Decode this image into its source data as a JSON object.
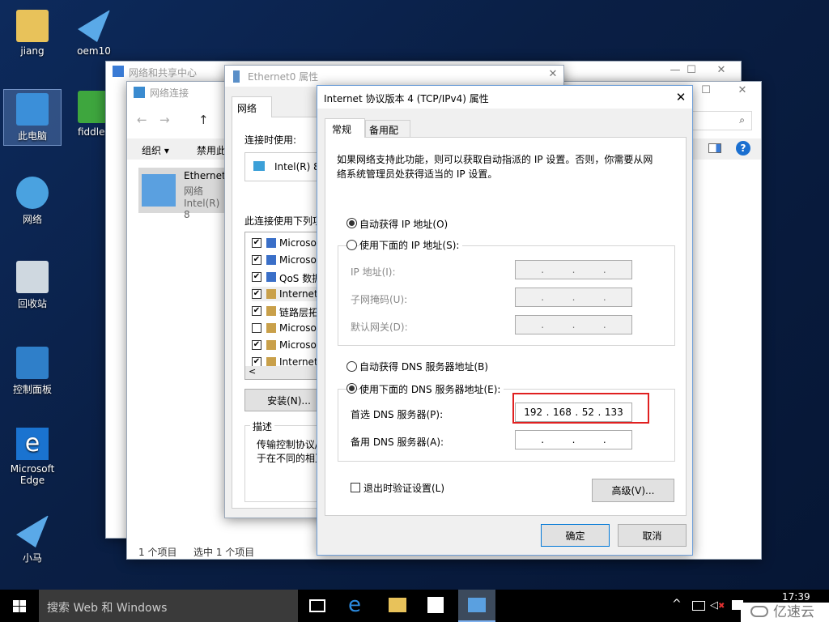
{
  "desktop": {
    "icons": [
      {
        "label": "jiang"
      },
      {
        "label": "此电脑"
      },
      {
        "label": "网络"
      },
      {
        "label": "回收站"
      },
      {
        "label": "控制面板"
      },
      {
        "label": "Microsoft Edge"
      },
      {
        "label": "小马"
      },
      {
        "label": "oem10"
      },
      {
        "label": "fiddle"
      }
    ]
  },
  "win_share": {
    "title": "网络和共享中心"
  },
  "win_conn": {
    "title": "网络连接",
    "organize": "组织 ▾",
    "disable": "禁用此",
    "item_name": "Ethernet",
    "item_type": "网络",
    "item_adapter": "Intel(R) 8",
    "status_count": "1 个项目",
    "status_selected": "选中 1 个项目"
  },
  "win_eth": {
    "title": "Ethernet0 属性",
    "tab": "网络",
    "connect_using": "连接时使用:",
    "adapter": "Intel(R) 8",
    "uses_items": "此连接使用下列项",
    "items": [
      {
        "label": "Microso",
        "checked": true
      },
      {
        "label": "Microso",
        "checked": true
      },
      {
        "label": "QoS 数据",
        "checked": true
      },
      {
        "label": "Internet",
        "checked": true
      },
      {
        "label": "链路层拓",
        "checked": true
      },
      {
        "label": "Microso",
        "checked": false
      },
      {
        "label": "Microso",
        "checked": true
      },
      {
        "label": "Internet",
        "checked": true
      }
    ],
    "install": "安装(N)...",
    "desc_title": "描述",
    "desc_line1": "传输控制协议/",
    "desc_line2": "于在不同的相互"
  },
  "dialog": {
    "title": "Internet 协议版本 4 (TCP/IPv4) 属性",
    "tabs": [
      "常规",
      "备用配置"
    ],
    "intro1": "如果网络支持此功能，则可以获取自动指派的 IP 设置。否则，你需要从网",
    "intro2": "络系统管理员处获得适当的 IP 设置。",
    "auto_ip": "自动获得 IP 地址(O)",
    "manual_ip": "使用下面的 IP 地址(S):",
    "ip_label": "IP 地址(I):",
    "mask_label": "子网掩码(U):",
    "gw_label": "默认网关(D):",
    "auto_dns": "自动获得 DNS 服务器地址(B)",
    "manual_dns": "使用下面的 DNS 服务器地址(E):",
    "pref_dns_label": "首选 DNS 服务器(P):",
    "pref_dns": [
      "192",
      "168",
      "52",
      "133"
    ],
    "alt_dns_label": "备用 DNS 服务器(A):",
    "validate": "退出时验证设置(L)",
    "advanced": "高级(V)...",
    "ok": "确定",
    "cancel": "取消",
    "selected_ip_mode": "auto",
    "selected_dns_mode": "manual",
    "highlight_color": "#e02020"
  },
  "taskbar": {
    "search": "搜索 Web 和 Windows",
    "time": "17:39",
    "watermark": "亿速云"
  }
}
